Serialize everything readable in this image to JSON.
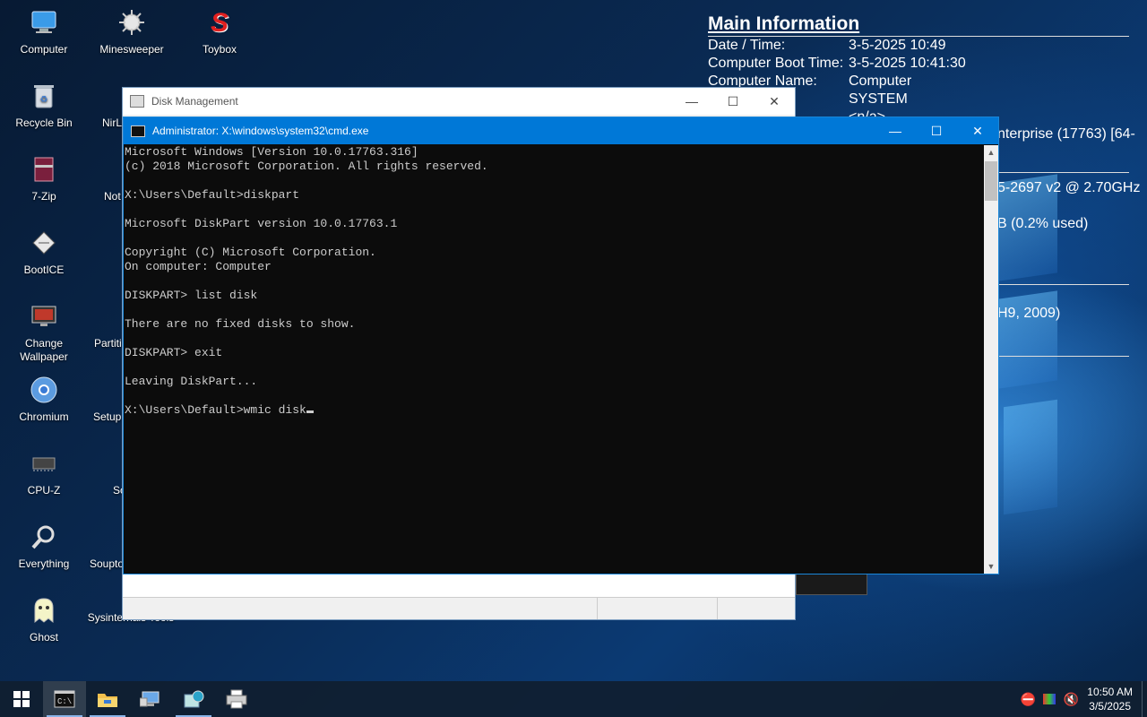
{
  "desktop_icons": [
    {
      "label": "Computer",
      "icon": "computer-icon"
    },
    {
      "label": "Minesweeper",
      "icon": "minesweeper-icon"
    },
    {
      "label": "Toybox",
      "icon": "toybox-icon"
    },
    {
      "label": "Recycle Bin",
      "icon": "recycle-bin-icon"
    },
    {
      "label": "7-Zip",
      "icon": "7zip-icon"
    },
    {
      "label": "BootICE",
      "icon": "bootice-icon"
    },
    {
      "label": "Change Wallpaper",
      "icon": "wallpaper-icon"
    },
    {
      "label": "Chromium",
      "icon": "chromium-icon"
    },
    {
      "label": "CPU-Z",
      "icon": "cpuz-icon"
    },
    {
      "label": "Everything",
      "icon": "magnifier-icon"
    },
    {
      "label": "Ghost",
      "icon": "ghost-icon"
    },
    {
      "label": "NirL",
      "icon": "nirlauncher-icon"
    },
    {
      "label": "Not",
      "icon": "notepad-icon"
    },
    {
      "label": "Partiti",
      "icon": "partition-icon"
    },
    {
      "label": "Setup",
      "icon": "setup-icon"
    },
    {
      "label": "So",
      "icon": "so-icon"
    },
    {
      "label": "Souptо",
      "icon": "souptoys-icon"
    },
    {
      "label": "Sysinternals Tools",
      "icon": "sysinternals-icon"
    }
  ],
  "info_panel": {
    "title": "Main Information",
    "rows": [
      {
        "key": "Date / Time:",
        "value": "3-5-2025 10:49"
      },
      {
        "key": "Computer Boot Time:",
        "value": "3-5-2025 10:41:30"
      },
      {
        "key": "Computer Name:",
        "value": "Computer"
      },
      {
        "key": "",
        "value": "SYSTEM"
      },
      {
        "key": "",
        "value": "<n/a>"
      }
    ],
    "partial_os": "nterprise (17763) [64-",
    "partial_cpu": "5-2697 v2 @ 2.70GHz",
    "partial_mem": "B (0.2% used)",
    "partial_bios": "H9, 2009)"
  },
  "disk_management": {
    "title": "Disk Management",
    "minimize": "—",
    "maximize": "☐",
    "close": "✕"
  },
  "cmd": {
    "title": "Administrator: X:\\windows\\system32\\cmd.exe",
    "minimize": "—",
    "maximize": "☐",
    "close": "✕",
    "lines": [
      "Microsoft Windows [Version 10.0.17763.316]",
      "(c) 2018 Microsoft Corporation. All rights reserved.",
      "",
      "X:\\Users\\Default>diskpart",
      "",
      "Microsoft DiskPart version 10.0.17763.1",
      "",
      "Copyright (C) Microsoft Corporation.",
      "On computer: Computer",
      "",
      "DISKPART> list disk",
      "",
      "There are no fixed disks to show.",
      "",
      "DISKPART> exit",
      "",
      "Leaving DiskPart...",
      ""
    ],
    "current_input": "X:\\Users\\Default>wmic disk"
  },
  "taskbar": {
    "items": [
      {
        "icon": "start-icon"
      },
      {
        "icon": "cmd-icon",
        "active": true
      },
      {
        "icon": "file-explorer-icon"
      },
      {
        "icon": "computer-management-icon"
      },
      {
        "icon": "disk-tool-icon"
      },
      {
        "icon": "printer-drive-icon"
      }
    ],
    "clock_time": "10:50 AM",
    "clock_date": "3/5/2025"
  }
}
